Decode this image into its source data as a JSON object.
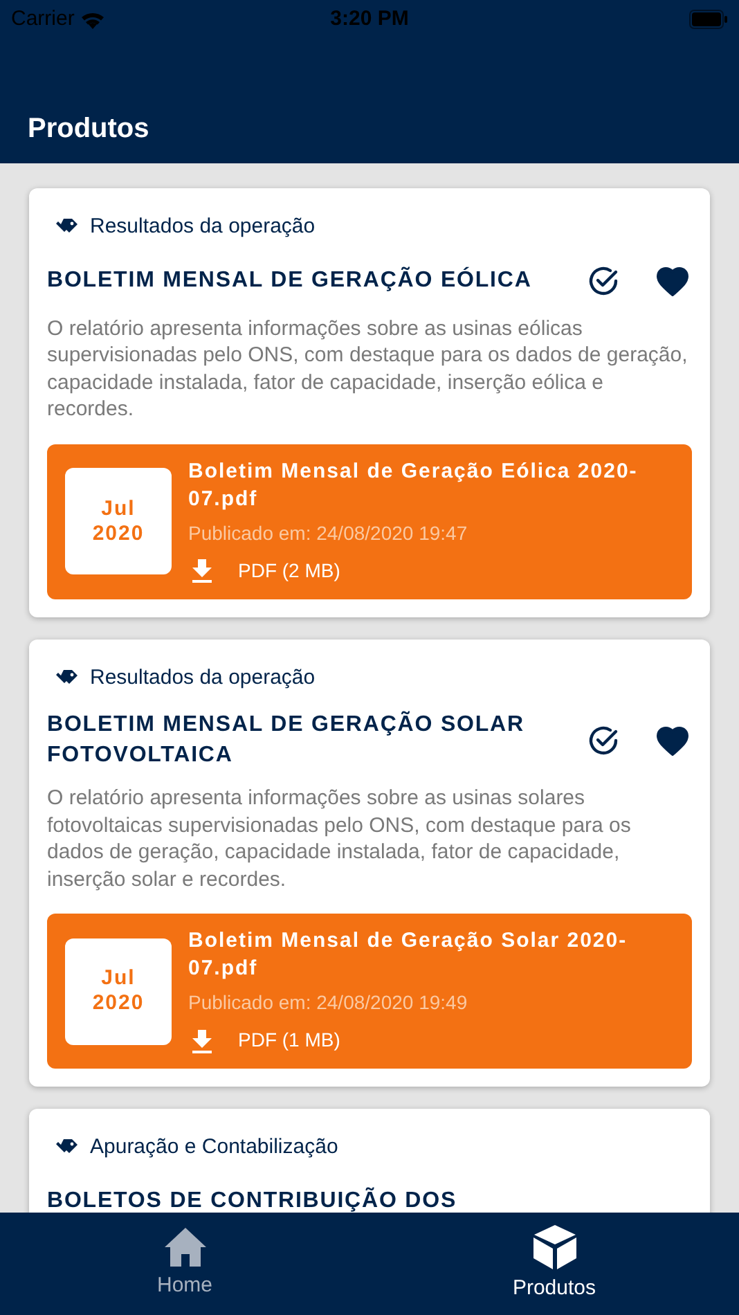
{
  "status_bar": {
    "carrier": "Carrier",
    "time": "3:20 PM"
  },
  "header": {
    "title": "Produtos"
  },
  "products": [
    {
      "category": "Resultados da operação",
      "title": "BOLETIM MENSAL DE GERAÇÃO EÓLICA",
      "favorite": true,
      "description": "O relatório apresenta informações sobre as usinas eólicas supervisionadas pelo ONS, com destaque para os dados de geração, capacidade instalada, fator de capacidade, inserção eólica e recordes.",
      "file": {
        "month": "Jul",
        "year": "2020",
        "name": "Boletim Mensal de Geração Eólica 2020-07.pdf",
        "published": "Publicado em: 24/08/2020 19:47",
        "download": "PDF (2 MB)"
      }
    },
    {
      "category": "Resultados da operação",
      "title": "BOLETIM MENSAL DE GERAÇÃO SOLAR FOTOVOLTAICA",
      "favorite": true,
      "description": "O relatório apresenta informações sobre as usinas solares fotovoltaicas supervisionadas pelo ONS, com destaque para os dados de geração, capacidade instalada, fator de capacidade, inserção solar e recordes.",
      "file": {
        "month": "Jul",
        "year": "2020",
        "name": "Boletim Mensal de Geração Solar 2020-07.pdf",
        "published": "Publicado em: 24/08/2020 19:49",
        "download": "PDF (1 MB)"
      }
    },
    {
      "category": "Apuração e Contabilização",
      "title": "BOLETOS DE CONTRIBUIÇÃO DOS"
    }
  ],
  "tab_bar": [
    {
      "label": "Home",
      "kind": "home",
      "selected": false
    },
    {
      "label": "Produtos",
      "kind": "products",
      "selected": true
    }
  ]
}
